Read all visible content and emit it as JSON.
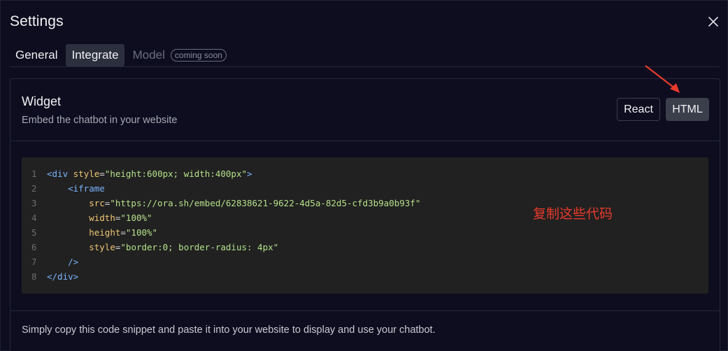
{
  "dialog": {
    "title": "Settings"
  },
  "tabs": [
    {
      "label": "General",
      "active": false
    },
    {
      "label": "Integrate",
      "active": true
    },
    {
      "label": "Model",
      "active": false,
      "disabled": true,
      "badge": "coming soon"
    }
  ],
  "widget": {
    "title": "Widget",
    "subtitle": "Embed the chatbot in your website",
    "buttons": {
      "react": "React",
      "html": "HTML"
    },
    "selected": "HTML"
  },
  "code": {
    "line_numbers": [
      "1",
      "2",
      "3",
      "4",
      "5",
      "6",
      "7",
      "8"
    ],
    "lines": [
      [
        [
          "tag",
          "<div "
        ],
        [
          "attr",
          "style"
        ],
        [
          "pun",
          "="
        ],
        [
          "str",
          "\"height:600px; width:400px\""
        ],
        [
          "tag",
          ">"
        ]
      ],
      [
        [
          "pun",
          "    "
        ],
        [
          "tag",
          "<iframe"
        ]
      ],
      [
        [
          "pun",
          "        "
        ],
        [
          "attr",
          "src"
        ],
        [
          "pun",
          "="
        ],
        [
          "str",
          "\"https://ora.sh/embed/62838621-9622-4d5a-82d5-cfd3b9a0b93f\""
        ]
      ],
      [
        [
          "pun",
          "        "
        ],
        [
          "attr",
          "width"
        ],
        [
          "pun",
          "="
        ],
        [
          "str",
          "\"100%\""
        ]
      ],
      [
        [
          "pun",
          "        "
        ],
        [
          "attr",
          "height"
        ],
        [
          "pun",
          "="
        ],
        [
          "str",
          "\"100%\""
        ]
      ],
      [
        [
          "pun",
          "        "
        ],
        [
          "attr",
          "style"
        ],
        [
          "pun",
          "="
        ],
        [
          "str",
          "\"border:0; border-radius: 4px\""
        ]
      ],
      [
        [
          "pun",
          "    "
        ],
        [
          "tag",
          "/>"
        ]
      ],
      [
        [
          "tag",
          "</div>"
        ]
      ]
    ]
  },
  "annotation": {
    "text": "复制这些代码",
    "color": "#e83a2c"
  },
  "footer": {
    "text": "Simply copy this code snippet and paste it into your website to display and use your chatbot."
  },
  "icons": {
    "close": "close-icon",
    "arrow": "red-arrow-annotation-icon"
  }
}
